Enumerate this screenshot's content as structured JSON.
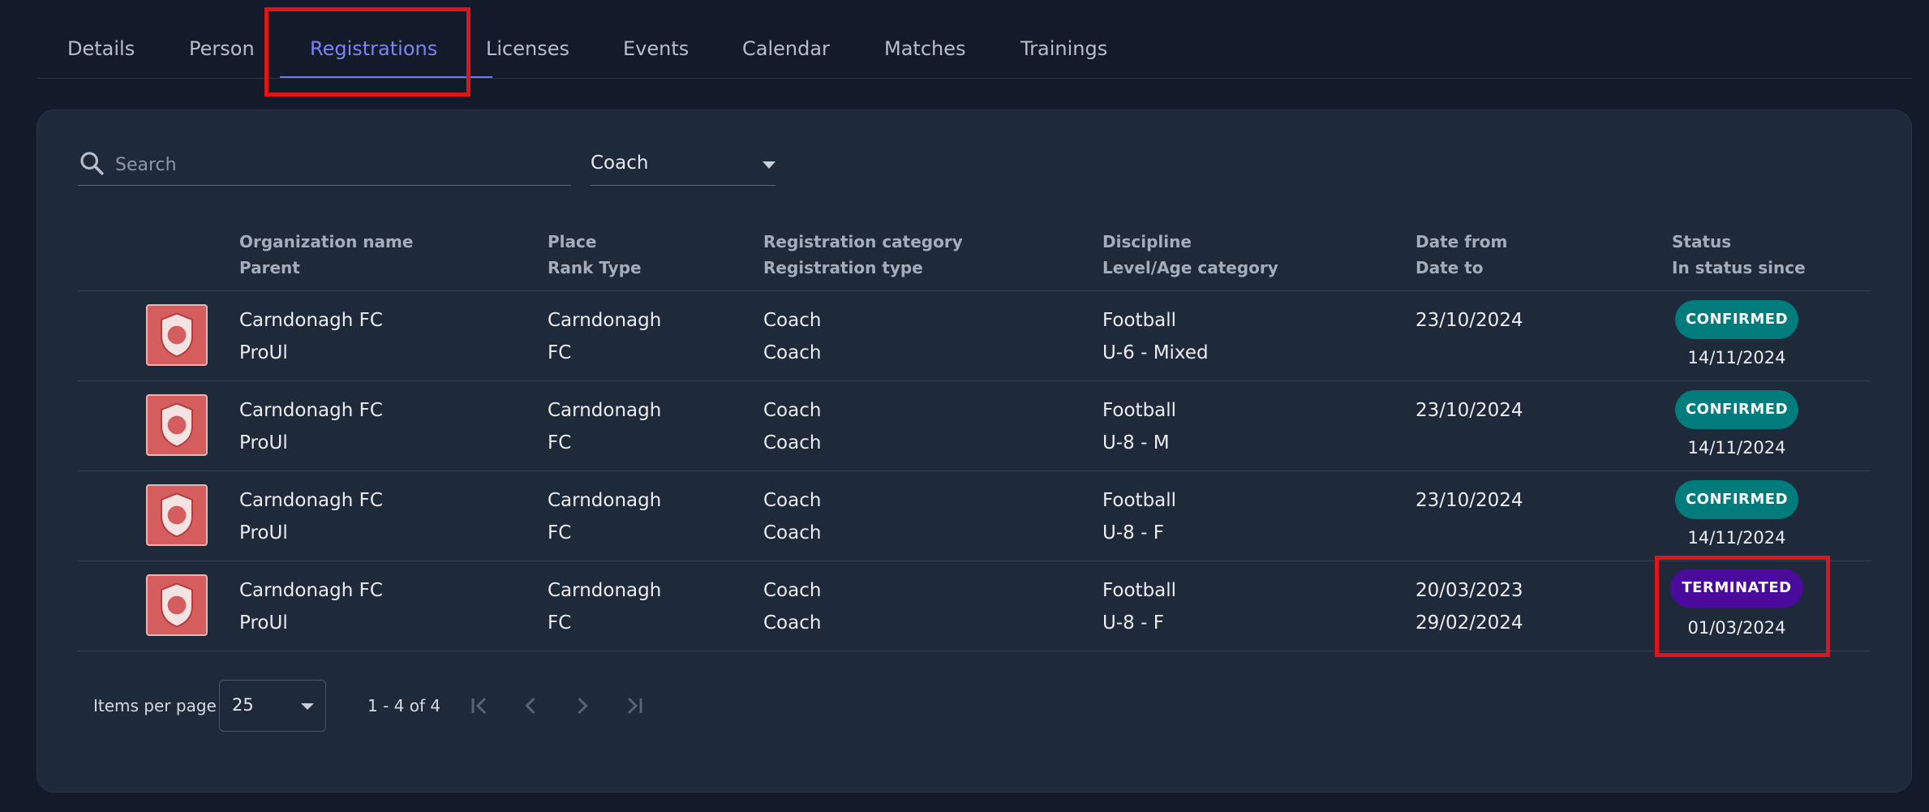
{
  "tabs": [
    {
      "label": "Details"
    },
    {
      "label": "Person"
    },
    {
      "label": "Registrations"
    },
    {
      "label": "Licenses"
    },
    {
      "label": "Events"
    },
    {
      "label": "Calendar"
    },
    {
      "label": "Matches"
    },
    {
      "label": "Trainings"
    }
  ],
  "active_tab": "Registrations",
  "filters": {
    "search_placeholder": "Search",
    "role_select": "Coach"
  },
  "columns": [
    {
      "line1": "Organization name",
      "line2": "Parent"
    },
    {
      "line1": "Place",
      "line2": "Rank Type"
    },
    {
      "line1": "Registration category",
      "line2": "Registration type"
    },
    {
      "line1": "Discipline",
      "line2": "Level/Age category"
    },
    {
      "line1": "Date from",
      "line2": "Date to"
    },
    {
      "line1": "Status",
      "line2": "In status since"
    }
  ],
  "rows": [
    {
      "org": "Carndonagh FC",
      "parent": "ProUl",
      "place": "Carndonagh",
      "rank_type": "FC",
      "reg_category": "Coach",
      "reg_type": "Coach",
      "discipline": "Football",
      "level": "U-6 - Mixed",
      "date_from": "23/10/2024",
      "date_to": "",
      "status": "CONFIRMED",
      "since": "14/11/2024"
    },
    {
      "org": "Carndonagh FC",
      "parent": "ProUl",
      "place": "Carndonagh",
      "rank_type": "FC",
      "reg_category": "Coach",
      "reg_type": "Coach",
      "discipline": "Football",
      "level": "U-8 - M",
      "date_from": "23/10/2024",
      "date_to": "",
      "status": "CONFIRMED",
      "since": "14/11/2024"
    },
    {
      "org": "Carndonagh FC",
      "parent": "ProUl",
      "place": "Carndonagh",
      "rank_type": "FC",
      "reg_category": "Coach",
      "reg_type": "Coach",
      "discipline": "Football",
      "level": "U-8 - F",
      "date_from": "23/10/2024",
      "date_to": "",
      "status": "CONFIRMED",
      "since": "14/11/2024"
    },
    {
      "org": "Carndonagh FC",
      "parent": "ProUl",
      "place": "Carndonagh",
      "rank_type": "FC",
      "reg_category": "Coach",
      "reg_type": "Coach",
      "discipline": "Football",
      "level": "U-8 - F",
      "date_from": "20/03/2023",
      "date_to": "29/02/2024",
      "status": "TERMINATED",
      "since": "01/03/2024"
    }
  ],
  "pagination": {
    "items_per_page_label": "Items per page",
    "items_per_page": "25",
    "range": "1 - 4 of 4"
  },
  "colors": {
    "background": "#131b2b",
    "card": "#1e293a",
    "accent": "#7b83f5",
    "confirmed": "#007c7c",
    "terminated": "#4a0a9b",
    "highlight": "#e0151c"
  },
  "icons": {
    "search": "search-icon",
    "dropdown": "chevron-down-icon",
    "first_page": "first-page-icon",
    "prev_page": "chevron-left-icon",
    "next_page": "chevron-right-icon",
    "last_page": "last-page-icon",
    "club_logo": "club-crest-icon"
  }
}
